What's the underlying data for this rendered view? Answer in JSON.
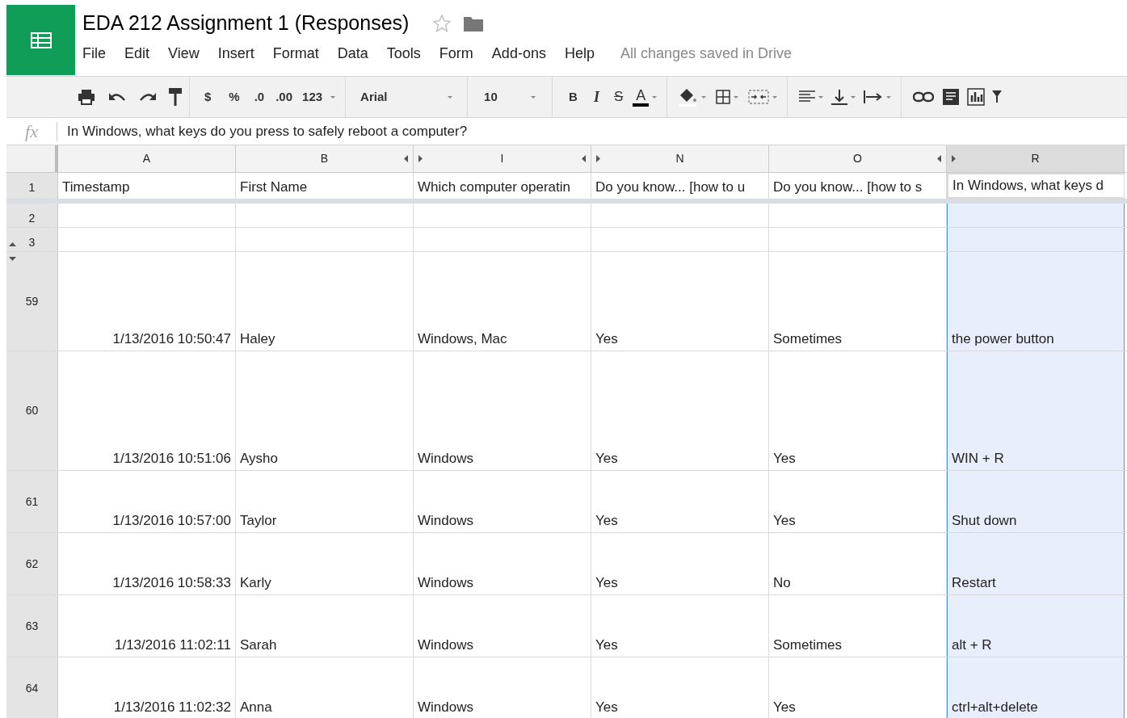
{
  "title": "EDA 212 Assignment 1 (Responses)",
  "starred": false,
  "menu": [
    "File",
    "Edit",
    "View",
    "Insert",
    "Format",
    "Data",
    "Tools",
    "Form",
    "Add-ons",
    "Help"
  ],
  "save_status": "All changes saved in Drive",
  "toolbar": {
    "currency": "$",
    "percent": "%",
    "decrease_decimals": ".0",
    "increase_decimals": ".00",
    "more_formats": "123",
    "font": "Arial",
    "font_size": "10",
    "bold": "B",
    "italic": "I",
    "strikethrough": "S",
    "text_color": "A"
  },
  "formula_bar": {
    "label": "fx",
    "value": "In Windows, what keys do you press to safely reboot a computer?"
  },
  "columns": [
    {
      "letter": "A",
      "selected": false,
      "hidden_before": false,
      "hidden_after": false
    },
    {
      "letter": "B",
      "selected": false,
      "hidden_before": false,
      "hidden_after": true
    },
    {
      "letter": "I",
      "selected": false,
      "hidden_before": true,
      "hidden_after": true
    },
    {
      "letter": "N",
      "selected": false,
      "hidden_before": true,
      "hidden_after": false
    },
    {
      "letter": "O",
      "selected": false,
      "hidden_before": false,
      "hidden_after": true
    },
    {
      "letter": "R",
      "selected": true,
      "hidden_before": true,
      "hidden_after": false
    }
  ],
  "rows": [
    {
      "number": "1",
      "hidden_before": false,
      "hidden_after": false,
      "cells": [
        "Timestamp",
        "First Name",
        "Which computer operatin",
        "Do you know... [how to u",
        "Do you know... [how to s",
        "In Windows, what keys d"
      ]
    },
    {
      "number": "2",
      "hidden_before": false,
      "hidden_after": false,
      "cells": [
        "",
        "",
        "",
        "",
        "",
        ""
      ]
    },
    {
      "number": "3",
      "hidden_before": false,
      "hidden_after": true,
      "cells": [
        "",
        "",
        "",
        "",
        "",
        ""
      ]
    },
    {
      "number": "59",
      "hidden_before": true,
      "hidden_after": false,
      "cells": [
        "1/13/2016 10:50:47",
        "Haley",
        "Windows, Mac",
        "Yes",
        "Sometimes",
        "the power button"
      ]
    },
    {
      "number": "60",
      "hidden_before": false,
      "hidden_after": false,
      "cells": [
        "1/13/2016 10:51:06",
        "Aysho",
        "Windows",
        "Yes",
        "Yes",
        "WIN + R"
      ]
    },
    {
      "number": "61",
      "hidden_before": false,
      "hidden_after": false,
      "cells": [
        "1/13/2016 10:57:00",
        "Taylor",
        "Windows",
        "Yes",
        "Yes",
        "Shut down"
      ]
    },
    {
      "number": "62",
      "hidden_before": false,
      "hidden_after": false,
      "cells": [
        "1/13/2016 10:58:33",
        "Karly",
        "Windows",
        "Yes",
        "No",
        "Restart"
      ]
    },
    {
      "number": "63",
      "hidden_before": false,
      "hidden_after": false,
      "cells": [
        "1/13/2016 11:02:11",
        "Sarah",
        "Windows",
        "Yes",
        "Sometimes",
        "alt + R"
      ]
    },
    {
      "number": "64",
      "hidden_before": false,
      "hidden_after": false,
      "cells": [
        "1/13/2016 11:02:32",
        "Anna",
        "Windows",
        "Yes",
        "Yes",
        "ctrl+alt+delete"
      ]
    }
  ]
}
